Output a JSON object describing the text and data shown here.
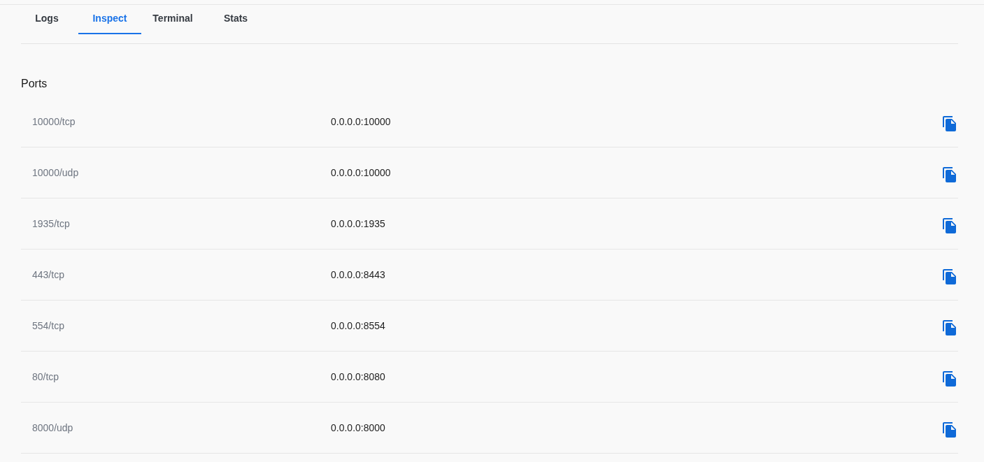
{
  "tabs": [
    {
      "label": "Logs",
      "selected": false
    },
    {
      "label": "Inspect",
      "selected": true
    },
    {
      "label": "Terminal",
      "selected": false
    },
    {
      "label": "Stats",
      "selected": false
    }
  ],
  "ports": {
    "title": "Ports",
    "rows": [
      {
        "port": "10000/tcp",
        "binding": "0.0.0.0:10000"
      },
      {
        "port": "10000/udp",
        "binding": "0.0.0.0:10000"
      },
      {
        "port": "1935/tcp",
        "binding": "0.0.0.0:1935"
      },
      {
        "port": "443/tcp",
        "binding": "0.0.0.0:8443"
      },
      {
        "port": "554/tcp",
        "binding": "0.0.0.0:8554"
      },
      {
        "port": "80/tcp",
        "binding": "0.0.0.0:8080"
      },
      {
        "port": "8000/udp",
        "binding": "0.0.0.0:8000"
      }
    ]
  }
}
